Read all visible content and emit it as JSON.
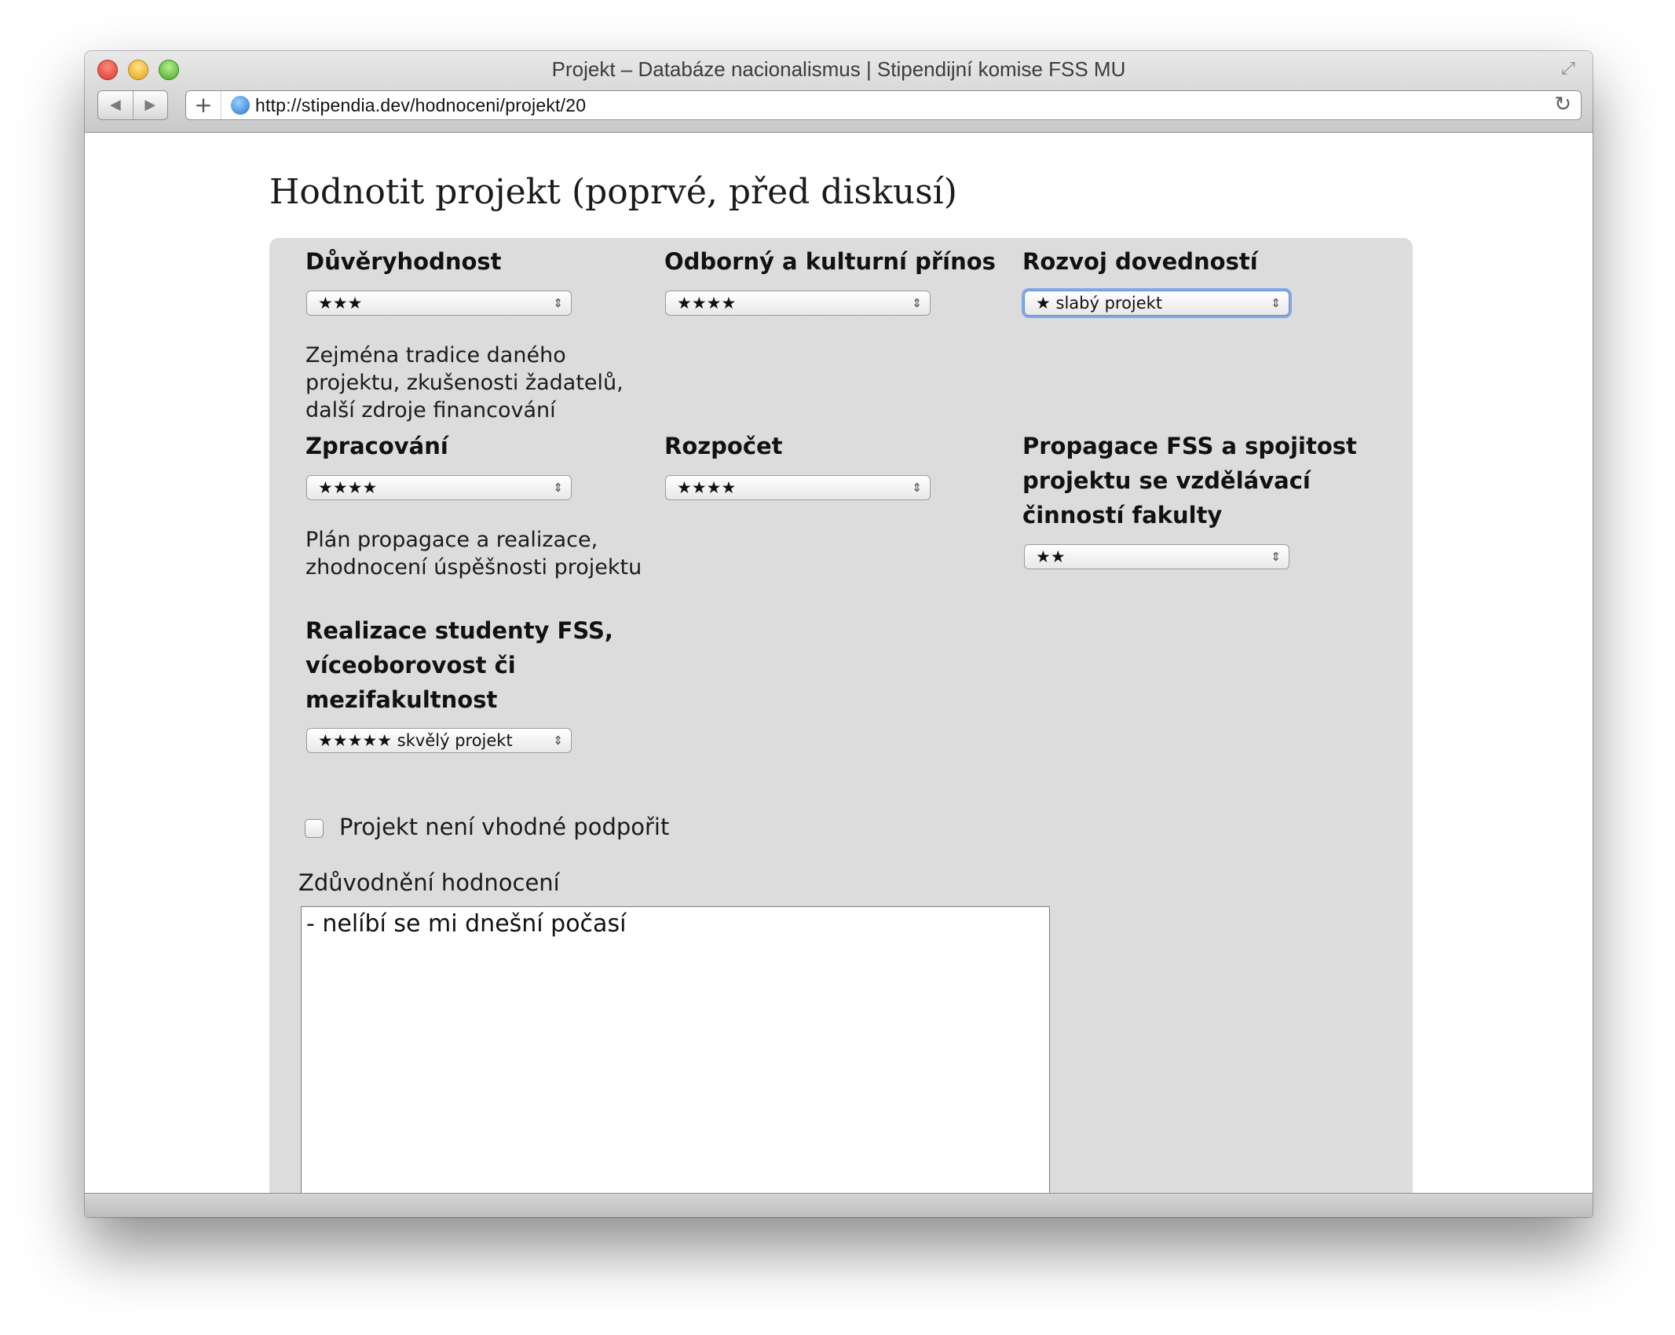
{
  "window": {
    "title": "Projekt – Databáze nacionalismus | Stipendijní komise FSS MU",
    "url": "http://stipendia.dev/hodnoceni/projekt/20",
    "nav_back": "◀",
    "nav_forward": "▶",
    "new_tab": "+",
    "reload": "↻",
    "fullscreen": "⤢"
  },
  "page": {
    "title": "Hodnotit projekt (poprvé, před diskusí)"
  },
  "criteria": [
    {
      "label": "Důvěryhodnost",
      "value": "★★★",
      "hint": "Zejména tradice daného projektu, zkušenosti žadatelů, další zdroje financování"
    },
    {
      "label": "Odborný a kulturní přínos",
      "value": "★★★★"
    },
    {
      "label": "Rozvoj dovedností",
      "value": "★ slabý projekt",
      "focused": true
    },
    {
      "label": "Zpracování",
      "value": "★★★★",
      "hint": "Plán propagace a realizace, zhodnocení úspěšnosti projektu"
    },
    {
      "label": "Rozpočet",
      "value": "★★★★"
    },
    {
      "label": "Propagace FSS a spojitost projektu se vzdělávací činností fakulty",
      "value": "★★"
    },
    {
      "label": "Realizace studenty FSS, víceoborovost či mezifakultnost",
      "value": "★★★★★ skvělý projekt"
    }
  ],
  "select_arrows": "⇕",
  "checkbox": {
    "label": "Projekt není vhodné podpořit",
    "checked": false
  },
  "justification": {
    "label": "Zdůvodnění hodnocení",
    "value": "- nelíbí se mi dnešní počasí"
  }
}
